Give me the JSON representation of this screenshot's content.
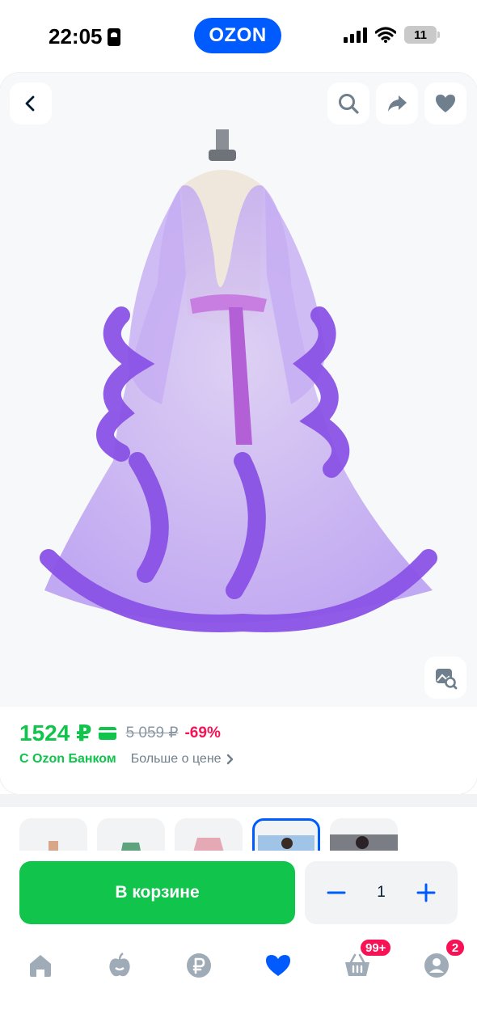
{
  "status_bar": {
    "time": "22:05",
    "app_pill": "OZON",
    "battery": "11"
  },
  "product": {
    "image_alt": "purple tulle robe with feather trim",
    "price": "1524 ₽",
    "old_price": "5 059 ₽",
    "discount": "-69%",
    "bank_label": "С Ozon Банком",
    "more_price_label": "Больше о цене"
  },
  "thumbnails": {
    "count": 5,
    "selected_index": 3
  },
  "action_bar": {
    "cart_label": "В корзине",
    "quantity": "1"
  },
  "tabbar": {
    "cart_badge": "99+",
    "profile_badge": "2",
    "items": [
      "home",
      "fresh",
      "finance",
      "favorites",
      "cart",
      "profile"
    ],
    "active": "favorites"
  },
  "colors": {
    "ozon_blue": "#005bff",
    "green": "#10c44c",
    "pink": "#f91155",
    "gray_icon": "#a0abb8"
  }
}
